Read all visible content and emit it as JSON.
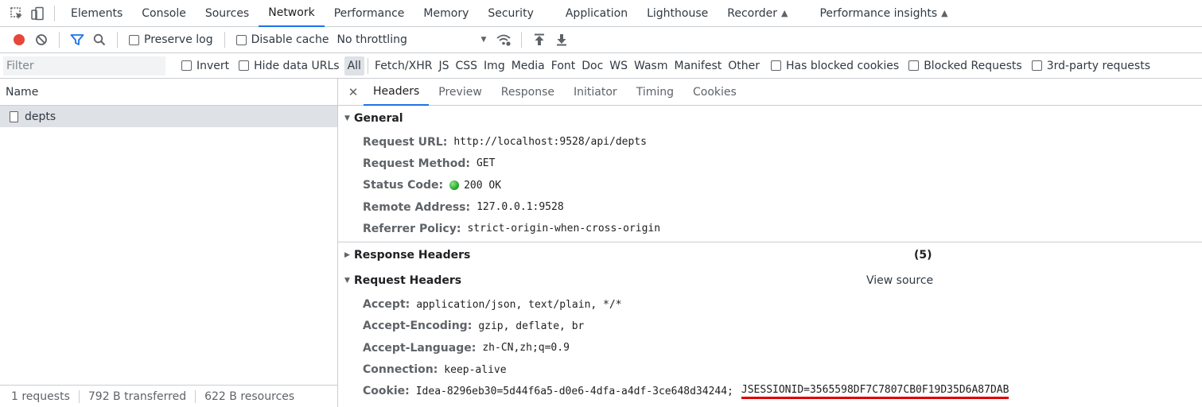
{
  "tabs": [
    "Elements",
    "Console",
    "Sources",
    "Network",
    "Performance",
    "Memory",
    "Security",
    "Application",
    "Lighthouse",
    "Recorder",
    "Performance insights"
  ],
  "active_tab": "Network",
  "toolbar": {
    "preserve_log": "Preserve log",
    "disable_cache": "Disable cache",
    "throttling": "No throttling"
  },
  "filter": {
    "placeholder": "Filter",
    "invert": "Invert",
    "hide_data_urls": "Hide data URLs",
    "types": [
      "All",
      "Fetch/XHR",
      "JS",
      "CSS",
      "Img",
      "Media",
      "Font",
      "Doc",
      "WS",
      "Wasm",
      "Manifest",
      "Other"
    ],
    "has_blocked_cookies": "Has blocked cookies",
    "blocked_requests": "Blocked Requests",
    "third_party": "3rd-party requests"
  },
  "request_list": {
    "header": "Name",
    "items": [
      "depts"
    ]
  },
  "status": {
    "requests": "1 requests",
    "transferred": "792 B transferred",
    "resources": "622 B resources"
  },
  "detail_tabs": [
    "Headers",
    "Preview",
    "Response",
    "Initiator",
    "Timing",
    "Cookies"
  ],
  "general": {
    "title": "General",
    "rows": [
      {
        "k": "Request URL:",
        "v": "http://localhost:9528/api/depts"
      },
      {
        "k": "Request Method:",
        "v": "GET"
      },
      {
        "k": "Status Code:",
        "v": "200 OK"
      },
      {
        "k": "Remote Address:",
        "v": "127.0.0.1:9528"
      },
      {
        "k": "Referrer Policy:",
        "v": "strict-origin-when-cross-origin"
      }
    ]
  },
  "response_headers": {
    "title": "Response Headers",
    "count": "(5)"
  },
  "request_headers": {
    "title": "Request Headers",
    "view_source": "View source",
    "rows": [
      {
        "k": "Accept:",
        "v": "application/json, text/plain, */*"
      },
      {
        "k": "Accept-Encoding:",
        "v": "gzip, deflate, br"
      },
      {
        "k": "Accept-Language:",
        "v": "zh-CN,zh;q=0.9"
      },
      {
        "k": "Connection:",
        "v": "keep-alive"
      }
    ],
    "cookie": {
      "k": "Cookie:",
      "v": "Idea-8296eb30=5d44f6a5-d0e6-4dfa-a4df-3ce648d34244;",
      "highlight": "JSESSIONID=3565598DF7C7807CB0F19D35D6A87DAB"
    }
  },
  "colors": {
    "accent": "#1a73e8",
    "record": "#e8453c",
    "underline": "#e00000",
    "status_ok": "#1e9e1e"
  }
}
